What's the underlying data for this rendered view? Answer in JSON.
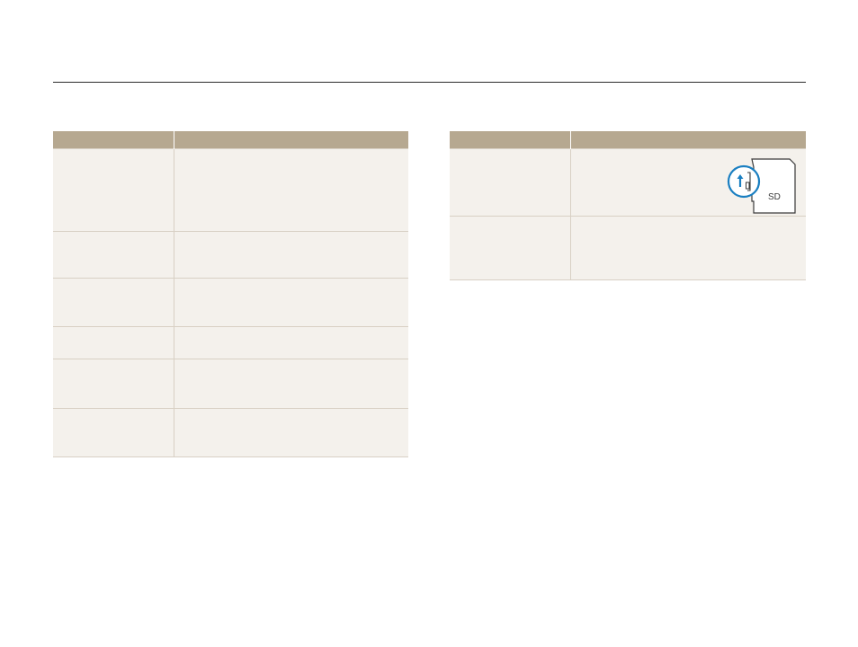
{
  "header": {
    "title": ""
  },
  "left_table": {
    "columns": [
      "",
      ""
    ],
    "rows": [
      {
        "col1": "",
        "col2": ""
      },
      {
        "col1": "",
        "col2": ""
      },
      {
        "col1": "",
        "col2": ""
      },
      {
        "col1": "",
        "col2": ""
      },
      {
        "col1": "",
        "col2": ""
      },
      {
        "col1": "",
        "col2": ""
      }
    ]
  },
  "right_table": {
    "columns": [
      "",
      ""
    ],
    "rows": [
      {
        "col1": "",
        "col2": ""
      },
      {
        "col1": "",
        "col2": ""
      }
    ],
    "figure": {
      "card_label": "SD",
      "icon": "sd-card-lock-switch-icon",
      "accent_color": "#1a7fc1"
    }
  },
  "colors": {
    "header_fill": "#b6a890",
    "row_fill": "#f4f1ec",
    "rule": "#2b2b2b",
    "divider": "#d8d0c4"
  }
}
